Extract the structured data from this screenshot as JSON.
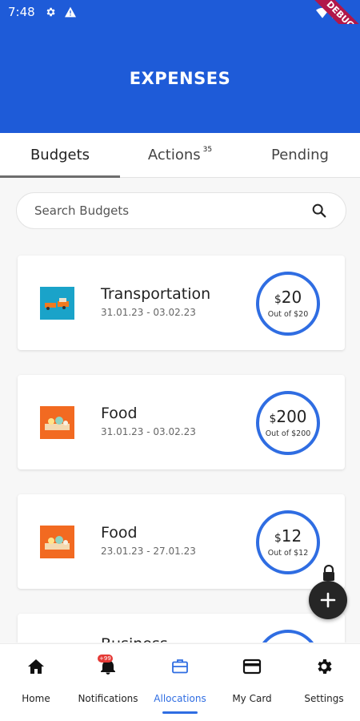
{
  "status_bar": {
    "time": "7:48",
    "ribbon": "DEBUG"
  },
  "header": {
    "title": "EXPENSES"
  },
  "tabs": [
    {
      "label": "Budgets",
      "active": true
    },
    {
      "label": "Actions",
      "badge": "35"
    },
    {
      "label": "Pending"
    }
  ],
  "search": {
    "placeholder": "Search Budgets"
  },
  "budgets": [
    {
      "name": "Transportation",
      "dates": "31.01.23 - 03.02.23",
      "currency": "$",
      "amount": "20",
      "out_of": "Out of $20",
      "icon": "transportation-icon"
    },
    {
      "name": "Food",
      "dates": "31.01.23 - 03.02.23",
      "currency": "$",
      "amount": "200",
      "out_of": "Out of $200",
      "icon": "food-icon"
    },
    {
      "name": "Food",
      "dates": "23.01.23 - 27.01.23",
      "currency": "$",
      "amount": "12",
      "out_of": "Out of $12",
      "icon": "food-icon"
    },
    {
      "name": "Business",
      "dates": "",
      "currency": "",
      "amount": "",
      "out_of": "",
      "icon": "business-icon"
    }
  ],
  "bottom_nav": [
    {
      "label": "Home",
      "icon": "home-icon"
    },
    {
      "label": "Notifications",
      "icon": "bell-icon",
      "badge": "+99"
    },
    {
      "label": "Allocations",
      "icon": "briefcase-icon",
      "active": true
    },
    {
      "label": "My Card",
      "icon": "card-icon"
    },
    {
      "label": "Settings",
      "icon": "gear-icon"
    }
  ],
  "colors": {
    "primary": "#1e5bd8",
    "accent": "#2f6de2",
    "fab": "#262626",
    "ribbon": "#b1174a"
  }
}
